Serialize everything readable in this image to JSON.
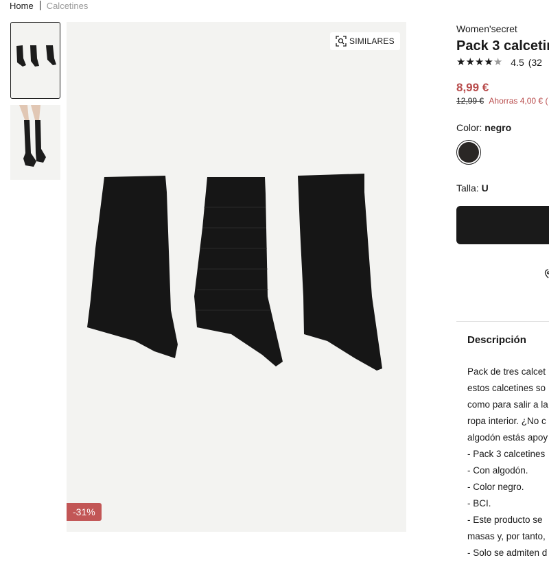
{
  "breadcrumb": {
    "home": "Home",
    "current": "Calcetines"
  },
  "gallery": {
    "thumbnails": [
      {
        "alt": "three black socks"
      },
      {
        "alt": "model wearing black socks"
      }
    ],
    "similares_label": "SIMILARES",
    "discount_badge": "-31%"
  },
  "product": {
    "brand": "Women'secret",
    "title": "Pack 3 calcetin",
    "rating": {
      "stars": 4.5,
      "value": "4.5",
      "count": "(32"
    },
    "price": "8,99 €",
    "old_price": "12,99 €",
    "savings": "Ahorras 4,00 € (",
    "color_label": "Color:",
    "color_value": "negro",
    "swatch_color": "#2a2725",
    "size_label": "Talla:",
    "size_value": "U"
  },
  "description": {
    "title": "Descripción",
    "lines": [
      "Pack de tres calcet",
      "estos calcetines so",
      "como para salir a la",
      "ropa interior. ¿No c",
      "algodón estás apoy",
      "- Pack 3 calcetines",
      "- Con algodón.",
      "- Color negro.",
      "- BCI.",
      "- Este producto se",
      "masas y, por tanto,",
      "- Solo se admiten d"
    ]
  },
  "colors": {
    "price_red": "#b84b4b",
    "badge_red": "#c25656",
    "dark": "#1a1a1a",
    "image_bg": "#f3f3f1"
  }
}
